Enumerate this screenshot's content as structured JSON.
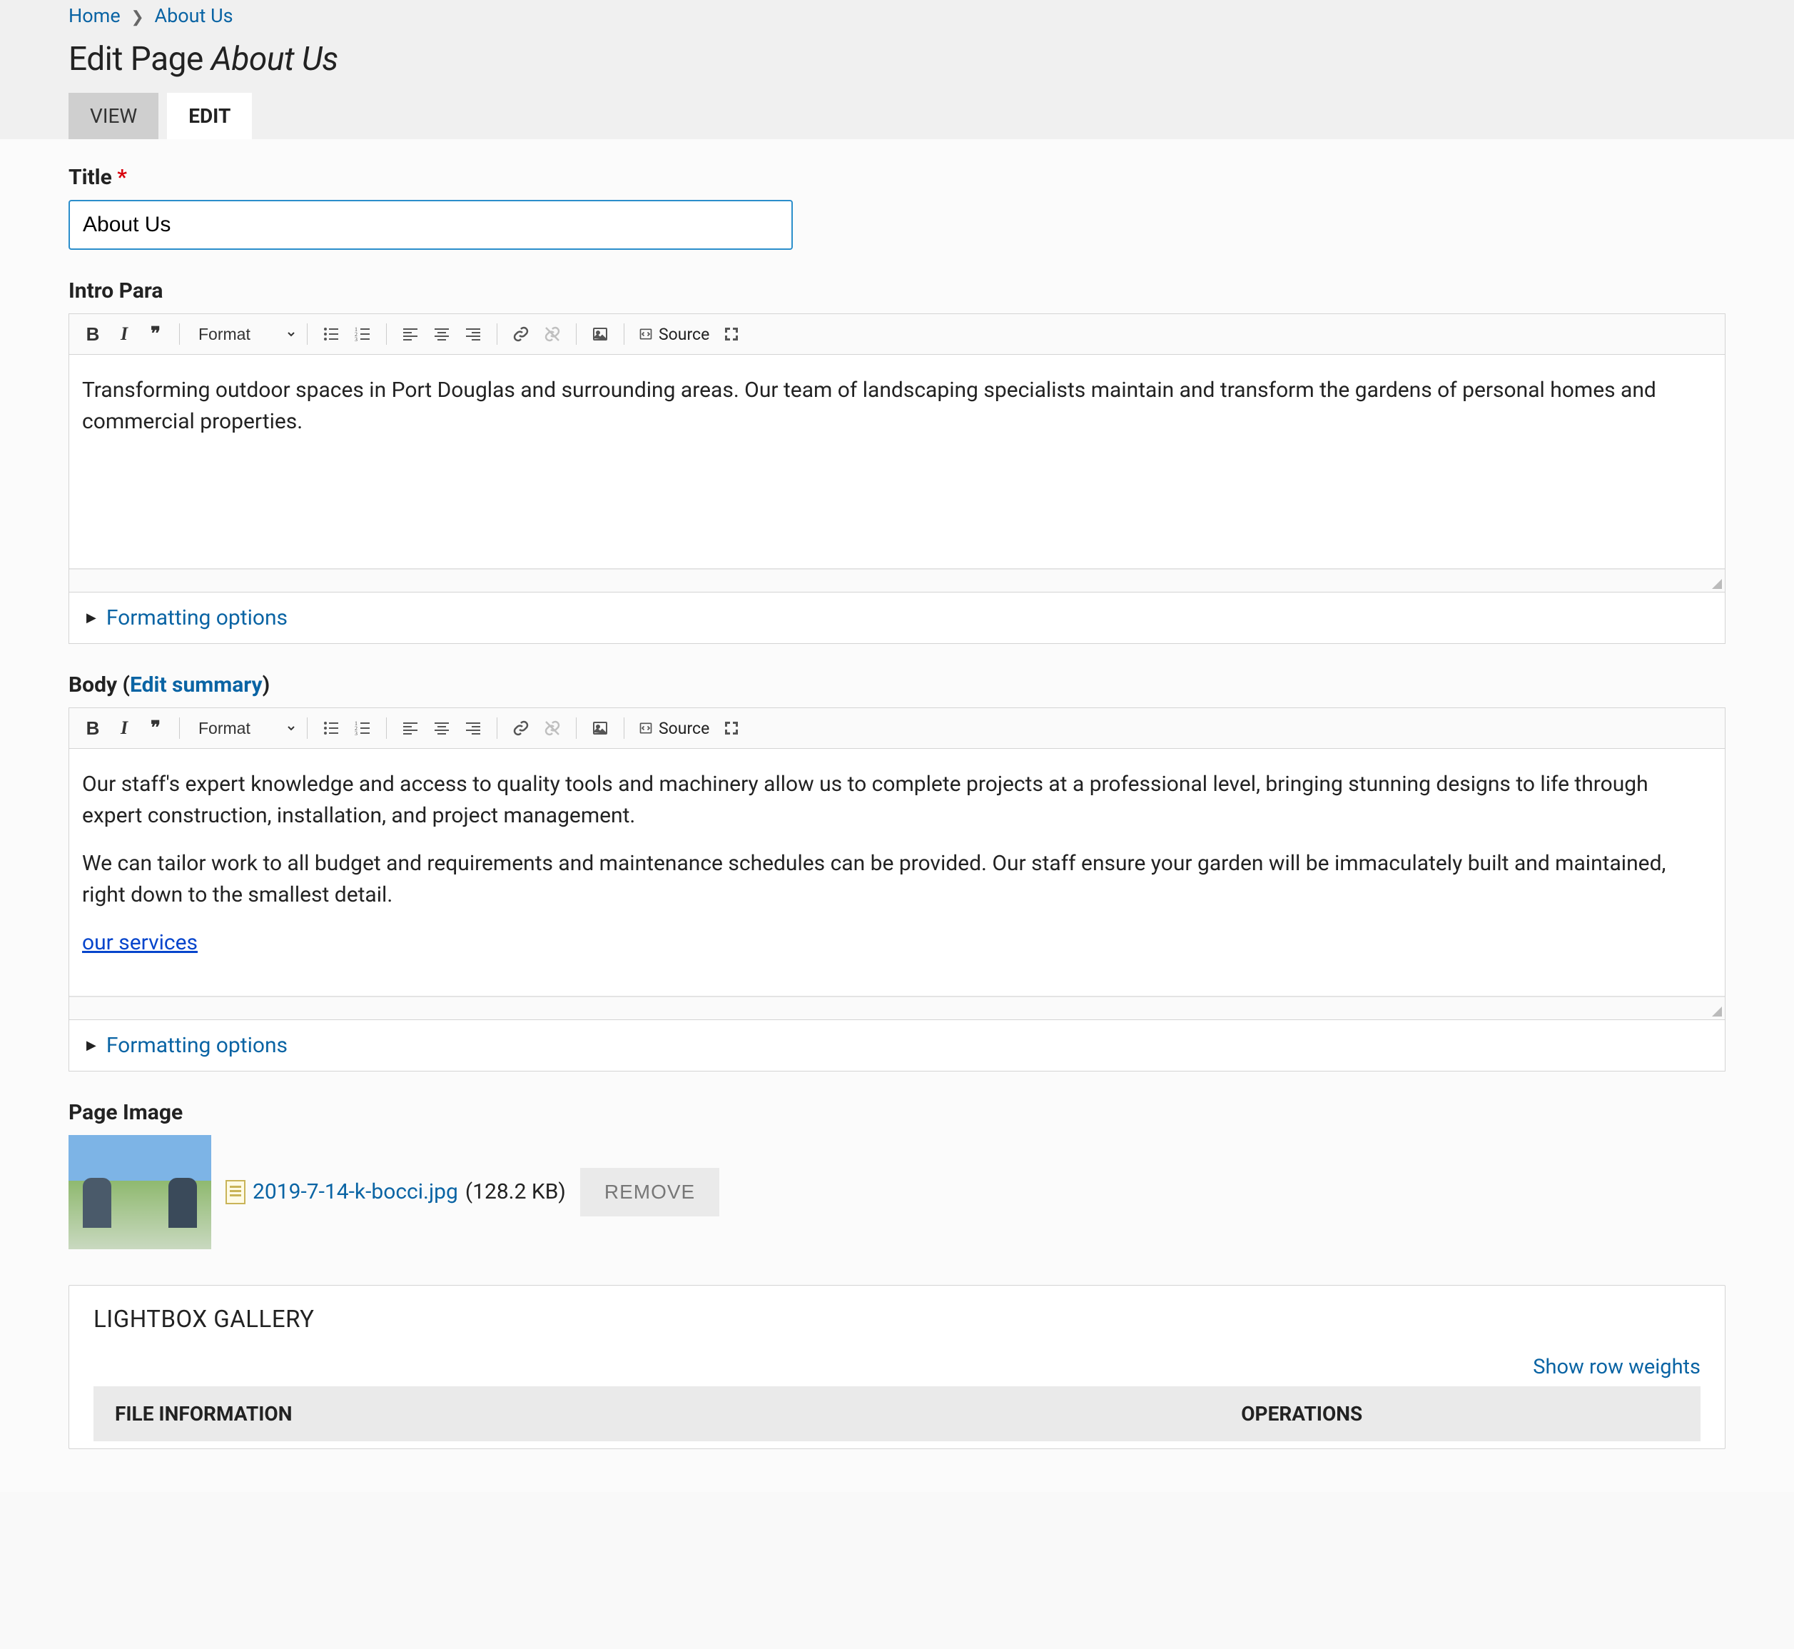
{
  "breadcrumb": {
    "home": "Home",
    "about": "About Us"
  },
  "page_title": {
    "prefix": "Edit Page ",
    "name": "About Us"
  },
  "tabs": {
    "view": "VIEW",
    "edit": "EDIT"
  },
  "title_field": {
    "label": "Title",
    "value": "About Us"
  },
  "intro": {
    "label": "Intro Para",
    "format_label": "Format",
    "source_label": "Source",
    "content": "Transforming outdoor spaces in Port Douglas and surrounding areas. Our team of landscaping specialists maintain and transform the gardens of personal homes and commercial properties.",
    "formatting_options": "Formatting options"
  },
  "body": {
    "label_prefix": "Body (",
    "edit_summary": "Edit summary",
    "label_suffix": ")",
    "format_label": "Format",
    "source_label": "Source",
    "p1": "Our staff's expert knowledge and access to quality tools and machinery allow us to complete projects at a professional level, bringing stunning designs to life through expert construction, installation, and project management.",
    "p2": "We can tailor work to all budget and requirements and maintenance schedules can be provided. Our staff ensure your garden will be immaculately built and maintained, right down to the smallest detail.",
    "link": "our services",
    "formatting_options": "Formatting options"
  },
  "page_image": {
    "label": "Page Image",
    "filename": "2019-7-14-k-bocci.jpg",
    "size": "(128.2 KB)",
    "remove": "REMOVE"
  },
  "gallery": {
    "title": "LIGHTBOX GALLERY",
    "show_weights": "Show row weights",
    "col_file": "FILE INFORMATION",
    "col_ops": "OPERATIONS"
  }
}
